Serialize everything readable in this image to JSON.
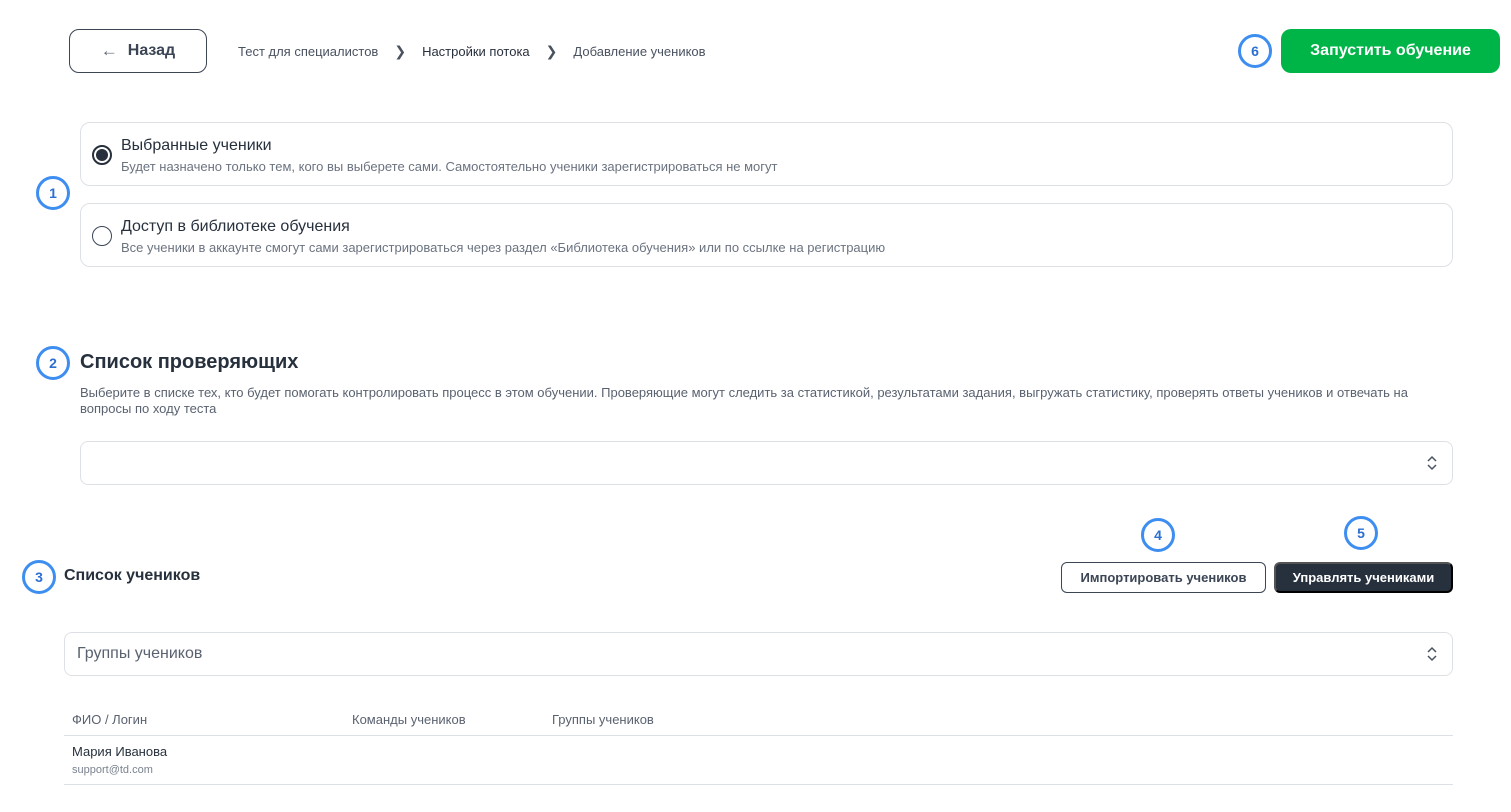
{
  "header": {
    "back_label": "Назад",
    "breadcrumb": [
      "Тест для специалистов",
      "Настройки потока",
      "Добавление учеников"
    ],
    "launch_label": "Запустить обучение"
  },
  "markers": [
    "1",
    "2",
    "3",
    "4",
    "5",
    "6"
  ],
  "access_options": [
    {
      "title": "Выбранные ученики",
      "description": "Будет назначено только тем, кого вы выберете сами. Самостоятельно ученики зарегистрироваться не могут",
      "selected": true
    },
    {
      "title": "Доступ в библиотеке обучения",
      "description": "Все ученики в аккаунте смогут сами зарегистрироваться через раздел «Библиотека обучения» или по ссылке на регистрацию",
      "selected": false
    }
  ],
  "reviewers": {
    "title": "Список проверяющих",
    "description": "Выберите в списке тех, кто будет помогать контролировать процесс в этом обучении. Проверяющие могут следить за статистикой, результатами задания, выгружать статистику, проверять ответы учеников и отвечать на вопросы по ходу теста",
    "select_value": ""
  },
  "students": {
    "title": "Список учеников",
    "import_label": "Импортировать учеников",
    "manage_label": "Управлять учениками",
    "groups_placeholder": "Группы учеников",
    "columns": [
      "ФИО / Логин",
      "Команды учеников",
      "Группы учеников"
    ],
    "rows": [
      {
        "name": "Мария Иванова",
        "login": "support@td.com",
        "teams": "",
        "groups": ""
      }
    ]
  },
  "colors": {
    "accent_green": "#00b548",
    "dark": "#27303d",
    "marker_blue": "#3d8ef0",
    "border": "#dde1e6"
  }
}
